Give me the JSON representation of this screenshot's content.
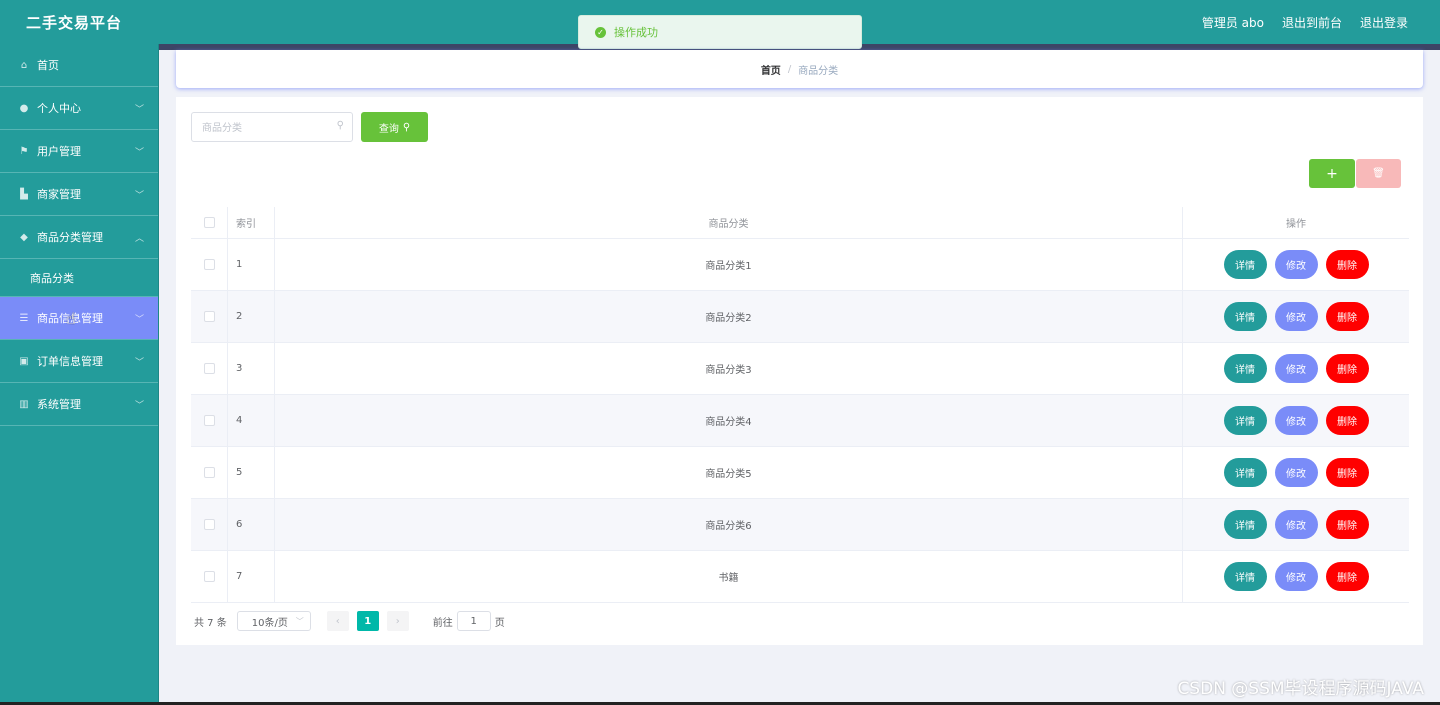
{
  "header": {
    "title": "二手交易平台",
    "user_label": "管理员 abo",
    "to_front_label": "退出到前台",
    "logout_label": "退出登录"
  },
  "toast": {
    "message": "操作成功"
  },
  "sidebar": {
    "items": [
      {
        "label": "首页",
        "icon": "home-icon"
      },
      {
        "label": "个人中心",
        "icon": "user-icon"
      },
      {
        "label": "用户管理",
        "icon": "flag-icon"
      },
      {
        "label": "商家管理",
        "icon": "shop-icon"
      },
      {
        "label": "商品分类管理",
        "icon": "location-icon"
      },
      {
        "label": "商品分类",
        "icon": ""
      },
      {
        "label": "商品信息管理",
        "icon": "list-icon"
      },
      {
        "label": "订单信息管理",
        "icon": "briefcase-icon"
      },
      {
        "label": "系统管理",
        "icon": "chart-icon"
      }
    ]
  },
  "breadcrumb": {
    "home": "首页",
    "separator": "/",
    "current": "商品分类"
  },
  "search": {
    "placeholder": "商品分类",
    "button_label": "查询"
  },
  "toolbar": {
    "add_label": "+",
    "delete_label": "🗑"
  },
  "table": {
    "headers": {
      "index": "索引",
      "category": "商品分类",
      "operation": "操作"
    },
    "rows": [
      {
        "index": "1",
        "category": "商品分类1"
      },
      {
        "index": "2",
        "category": "商品分类2"
      },
      {
        "index": "3",
        "category": "商品分类3"
      },
      {
        "index": "4",
        "category": "商品分类4"
      },
      {
        "index": "5",
        "category": "商品分类5"
      },
      {
        "index": "6",
        "category": "商品分类6"
      },
      {
        "index": "7",
        "category": "书籍"
      }
    ],
    "actions": {
      "detail": "详情",
      "edit": "修改",
      "delete": "删除"
    }
  },
  "pagination": {
    "total_text": "共 7 条",
    "page_size": "10条/页",
    "current_page": "1",
    "goto_label": "前往",
    "goto_value": "1",
    "page_suffix": "页"
  },
  "watermark": "CSDN @SSM毕设程序源码JAVA",
  "colors": {
    "primary": "#239c9b",
    "active_menu": "#7a8cf8",
    "success": "#67c23a",
    "danger": "#ff0000"
  }
}
